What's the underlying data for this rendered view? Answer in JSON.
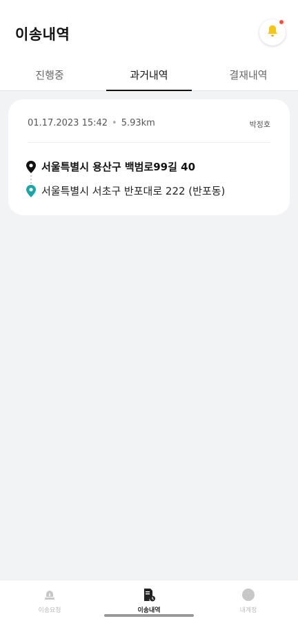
{
  "header": {
    "title": "이송내역"
  },
  "tabs": [
    {
      "label": "진행중",
      "active": false
    },
    {
      "label": "과거내역",
      "active": true
    },
    {
      "label": "결재내역",
      "active": false
    }
  ],
  "history": [
    {
      "datetime": "01.17.2023 15:42",
      "distance": "5.93km",
      "driver": "박정호",
      "from": "서울특별시 용산구 백범로99길 40",
      "to": "서울특별시 서초구 반포대로 222 (반포동)"
    }
  ],
  "bottom_nav": [
    {
      "label": "이송요청",
      "icon": "ambulance-siren-icon",
      "active": false
    },
    {
      "label": "이송내역",
      "icon": "document-clock-icon",
      "active": true
    },
    {
      "label": "내계정",
      "icon": "profile-icon",
      "active": false
    }
  ],
  "colors": {
    "accent": "#111111",
    "bell": "#f5c518",
    "notification_dot": "#ff4d3d",
    "destination_pin": "#1aa6a6",
    "background": "#f2f3f5"
  }
}
